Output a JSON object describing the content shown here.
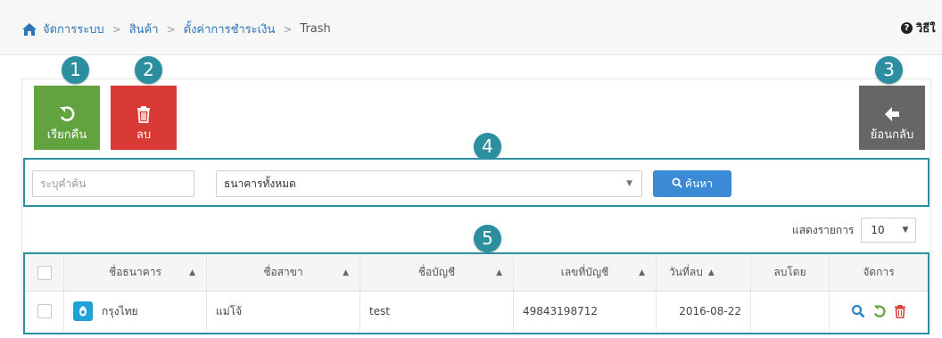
{
  "breadcrumb": {
    "items": [
      "จัดการระบบ",
      "สินค้า",
      "ตั้งค่าการชำระเงิน"
    ],
    "current": "Trash"
  },
  "help_label": "วิธีใ",
  "toolbar": {
    "restore_label": "เรียกคืน",
    "delete_label": "ลบ",
    "back_label": "ย้อนกลับ"
  },
  "callouts": [
    "1",
    "2",
    "3",
    "4",
    "5"
  ],
  "search": {
    "keyword_placeholder": "ระบุคำค้น",
    "bank_selected": "ธนาคารทั้งหมด",
    "search_label": "ค้นหา"
  },
  "page_size": {
    "label": "แสดงรายการ",
    "value": "10"
  },
  "table": {
    "headers": [
      "ชื่อธนาคาร",
      "ชื่อสาขา",
      "ชื่อบัญชี",
      "เลขที่บัญชี",
      "วันที่ลบ",
      "ลบโดย",
      "จัดการ"
    ],
    "rows": [
      {
        "bank": "กรุงไทย",
        "branch": "แม่โจ้",
        "account_name": "test",
        "account_no": "49843198712",
        "deleted_date": "2016-08-22",
        "deleted_by": ""
      }
    ]
  },
  "colors": {
    "restore": "#62a33f",
    "delete": "#d93a35",
    "back": "#666666",
    "callout": "#2b8fa0",
    "search_button": "#3a8ad6",
    "link": "#2e75b6"
  },
  "icons": [
    "home-icon",
    "help-icon",
    "undo-icon",
    "trash-icon",
    "arrow-left-icon",
    "search-icon",
    "sort-icon",
    "bank-logo-icon",
    "view-icon",
    "restore-icon",
    "delete-icon"
  ]
}
